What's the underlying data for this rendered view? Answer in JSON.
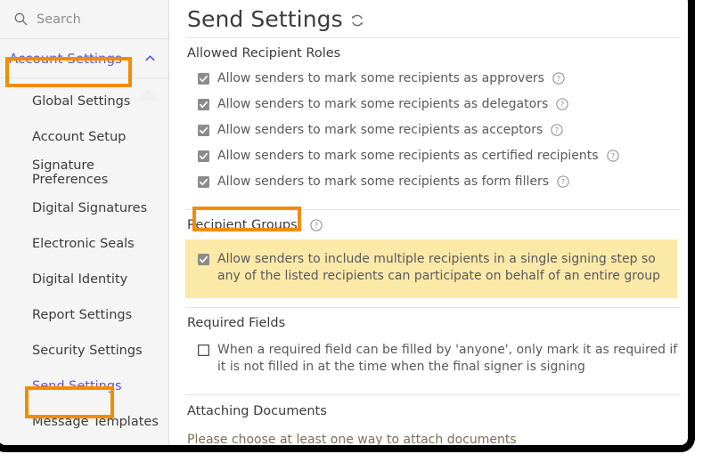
{
  "sidebar": {
    "search": {
      "placeholder": "Search",
      "value": "",
      "icon": "search-icon"
    },
    "accordion": {
      "label": "Account Settings",
      "chevron": "chevron-up-icon"
    },
    "items": [
      {
        "label": "Global Settings",
        "selected": false
      },
      {
        "label": "Account Setup",
        "selected": false
      },
      {
        "label": "Signature Preferences",
        "selected": false
      },
      {
        "label": "Digital Signatures",
        "selected": false
      },
      {
        "label": "Electronic Seals",
        "selected": false
      },
      {
        "label": "Digital Identity",
        "selected": false
      },
      {
        "label": "Report Settings",
        "selected": false
      },
      {
        "label": "Security Settings",
        "selected": false
      },
      {
        "label": "Send Settings",
        "selected": true
      },
      {
        "label": "Message Templates",
        "selected": false
      }
    ]
  },
  "main": {
    "title": "Send Settings",
    "refresh_icon": "refresh-icon",
    "sections": {
      "allowed_recipient_roles": {
        "heading": "Allowed Recipient Roles",
        "options": [
          {
            "label": "Allow senders to mark some recipients as approvers",
            "checked": true,
            "help": true
          },
          {
            "label": "Allow senders to mark some recipients as delegators",
            "checked": true,
            "help": true
          },
          {
            "label": "Allow senders to mark some recipients as acceptors",
            "checked": true,
            "help": true
          },
          {
            "label": "Allow senders to mark some recipients as certified recipients",
            "checked": true,
            "help": true
          },
          {
            "label": "Allow senders to mark some recipients as form fillers",
            "checked": true,
            "help": true
          }
        ]
      },
      "recipient_groups": {
        "heading": "Recipient Groups",
        "help": true,
        "options": [
          {
            "label": "Allow senders to include multiple recipients in a single signing step so any of the listed recipients can participate on behalf of an entire group",
            "checked": true,
            "help": false
          }
        ]
      },
      "required_fields": {
        "heading": "Required Fields",
        "options": [
          {
            "label": "When a required field can be filled by 'anyone', only mark it as required if it is not filled in at the time when the final signer is signing",
            "checked": false,
            "help": false
          }
        ]
      },
      "attaching_documents": {
        "heading": "Attaching Documents",
        "note": "Please choose at least one way to attach documents"
      }
    }
  },
  "colors": {
    "callout_orange": "#f28c00",
    "link_blue": "#5a5ac8",
    "highlight_yellow": "#fbe9a7",
    "sidebar_bg": "#f5f5f5"
  }
}
